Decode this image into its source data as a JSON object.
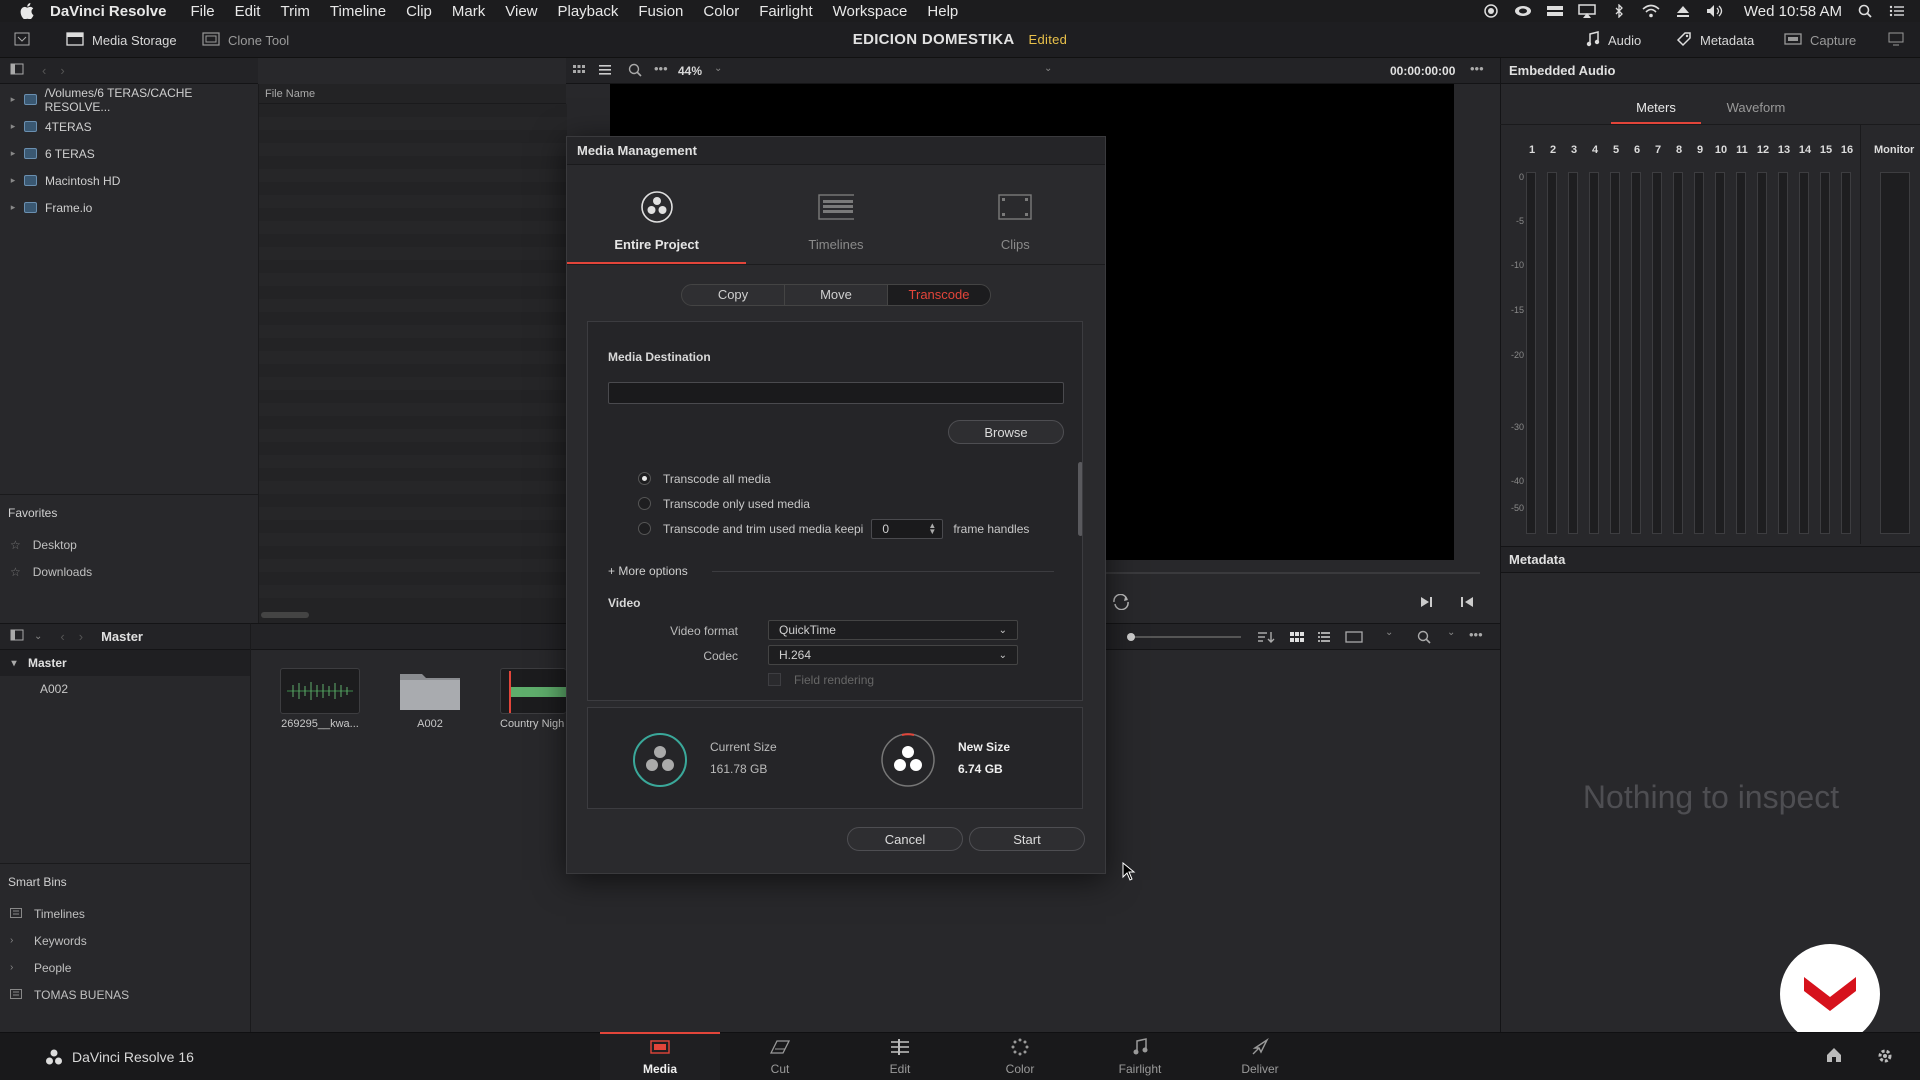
{
  "menubar": {
    "app_name": "DaVinci Resolve",
    "items": [
      "File",
      "Edit",
      "Trim",
      "Timeline",
      "Clip",
      "Mark",
      "View",
      "Playback",
      "Fusion",
      "Color",
      "Fairlight",
      "Workspace",
      "Help"
    ],
    "clock": "Wed 10:58 AM"
  },
  "toolbar": {
    "media_storage": "Media Storage",
    "clone_tool": "Clone Tool",
    "project_title": "EDICION DOMESTIKA",
    "edited": "Edited",
    "audio": "Audio",
    "metadata": "Metadata",
    "capture": "Capture"
  },
  "viewer": {
    "zoom": "44%",
    "timecode": "00:00:00:00"
  },
  "media_storage": {
    "drives": [
      "/Volumes/6 TERAS/CACHE RESOLVE...",
      "4TERAS",
      "6 TERAS",
      "Macintosh HD",
      "Frame.io"
    ],
    "file_name_header": "File Name"
  },
  "favorites": {
    "title": "Favorites",
    "items": [
      "Desktop",
      "Downloads"
    ]
  },
  "media_pool": {
    "bin_title": "Master",
    "master": "Master",
    "sub": "A002",
    "clips": [
      "269295__kwa...",
      "A002",
      "Country Nigh"
    ]
  },
  "smart_bins": {
    "title": "Smart Bins",
    "items": [
      "Timelines",
      "Keywords",
      "People",
      "TOMAS BUENAS"
    ]
  },
  "audio_panel": {
    "title": "Embedded Audio",
    "tabs": [
      "Meters",
      "Waveform"
    ],
    "channels": [
      "1",
      "2",
      "3",
      "4",
      "5",
      "6",
      "7",
      "8",
      "9",
      "10",
      "11",
      "12",
      "13",
      "14",
      "15",
      "16"
    ],
    "monitor": "Monitor",
    "scale": [
      "0",
      "-5",
      "-10",
      "-15",
      "-20",
      "-30",
      "-40",
      "-50"
    ]
  },
  "metadata_panel": {
    "title": "Metadata",
    "empty": "Nothing to inspect"
  },
  "dialog": {
    "title": "Media Management",
    "modes": [
      "Entire Project",
      "Timelines",
      "Clips"
    ],
    "actions": [
      "Copy",
      "Move",
      "Transcode"
    ],
    "media_destination": "Media Destination",
    "browse": "Browse",
    "options": [
      "Transcode all media",
      "Transcode only used media",
      "Transcode and trim used media keepi"
    ],
    "handles_value": "0",
    "handles_label": "frame handles",
    "more_options": "+ More options",
    "video_section": "Video",
    "video_format_label": "Video format",
    "video_format_value": "QuickTime",
    "codec_label": "Codec",
    "codec_value": "H.264",
    "field_rendering": "Field rendering",
    "current_size_label": "Current Size",
    "current_size_value": "161.78 GB",
    "new_size_label": "New Size",
    "new_size_value": "6.74 GB",
    "cancel": "Cancel",
    "start": "Start"
  },
  "pages": [
    "Media",
    "Cut",
    "Edit",
    "Color",
    "Fairlight",
    "Deliver"
  ],
  "footer": {
    "app_version": "DaVinci Resolve 16"
  },
  "colors": {
    "accent": "#e2453a",
    "edited": "#e8c04a",
    "teal": "#3aa89a"
  }
}
